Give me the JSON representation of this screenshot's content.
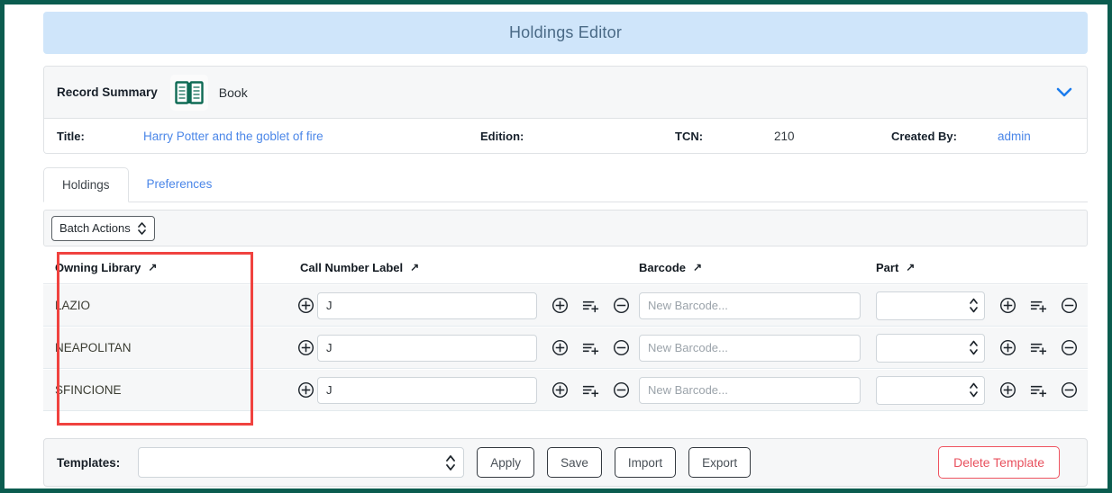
{
  "window": {
    "title": "Holdings Editor",
    "border_color": "#0b5c4f",
    "title_bg": "#cfe5fa"
  },
  "record_summary": {
    "label": "Record Summary",
    "icon": "book-icon",
    "record_type": "Book",
    "collapse_icon": "chevron-down-icon",
    "fields": [
      {
        "key": "Title:",
        "value": "Harry Potter and the goblet of fire",
        "style": "link"
      },
      {
        "key": "Edition:",
        "value": "",
        "style": "plain"
      },
      {
        "key": "TCN:",
        "value": "210",
        "style": "plain"
      },
      {
        "key": "Created By:",
        "value": "admin",
        "style": "link"
      }
    ]
  },
  "tabs": [
    {
      "label": "Holdings",
      "active": true
    },
    {
      "label": "Preferences",
      "active": false
    }
  ],
  "toolbar": {
    "batch_actions_label": "Batch Actions",
    "batch_actions_icon": "stepper-icon"
  },
  "grid": {
    "highlight_color": "#f0423f",
    "sort_icon": "sort-arrow-icon",
    "columns": [
      {
        "label": "Owning Library",
        "sortable": true
      },
      {
        "label": "Call Number Label",
        "sortable": true
      },
      {
        "label": "Barcode",
        "sortable": true
      },
      {
        "label": "Part",
        "sortable": true
      }
    ],
    "rows": [
      {
        "owning_library": "LAZIO",
        "call_number_value": "J",
        "call_number_placeholder": "",
        "barcode_value": "",
        "barcode_placeholder": "New Barcode...",
        "part_value": ""
      },
      {
        "owning_library": "NEAPOLITAN",
        "call_number_value": "J",
        "call_number_placeholder": "",
        "barcode_value": "",
        "barcode_placeholder": "New Barcode...",
        "part_value": ""
      },
      {
        "owning_library": "SFINCIONE",
        "call_number_value": "J",
        "call_number_placeholder": "",
        "barcode_value": "",
        "barcode_placeholder": "New Barcode...",
        "part_value": ""
      }
    ],
    "row_icons": {
      "add": "circle-plus-icon",
      "add_multiple": "list-add-icon",
      "remove": "circle-minus-icon"
    }
  },
  "footer": {
    "templates_label": "Templates:",
    "template_value": "",
    "buttons": [
      {
        "label": "Apply"
      },
      {
        "label": "Save"
      },
      {
        "label": "Import"
      },
      {
        "label": "Export"
      }
    ],
    "delete_label": "Delete Template",
    "delete_color": "#e8515e"
  }
}
